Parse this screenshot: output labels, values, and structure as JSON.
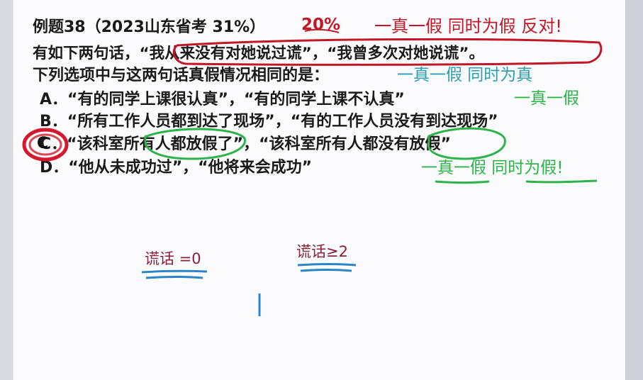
{
  "problem": {
    "title": "例题38（2023山东省考 31%）",
    "line1": "有如下两句话，“我从来没有对她说过谎”，“我曾多次对她说谎”。",
    "line2": "下列选项中与这两句话真假情况相同的是：",
    "options": [
      {
        "text": "A．“有的同学上课很认真”，“有的同学上课不认真”"
      },
      {
        "text": "B．“所有工作人员都到达了现场”，“有的工作人员没有到达现场”"
      },
      {
        "text": "C．“该科室所有人都放假了”，“该科室所有人都没有放假”"
      },
      {
        "text": "D．“他从未成功过”，“他将来会成功”"
      }
    ]
  },
  "annotations": {
    "percent": "20%",
    "header_note": "一真一假  同时为假  反对!",
    "line2_note": "一真一假  同时为真",
    "option_a_note": "一真一假",
    "option_d_note": "一真一假 同时为假!",
    "answer_circle": "C",
    "lie_zero": "谎话 =0",
    "lie_two": "谎话≥2"
  },
  "colors": {
    "ink": "#1a1a1a",
    "red": "#c01826",
    "green": "#2db34a",
    "blue": "#2c84c9",
    "maroon": "#8a1f3a"
  }
}
